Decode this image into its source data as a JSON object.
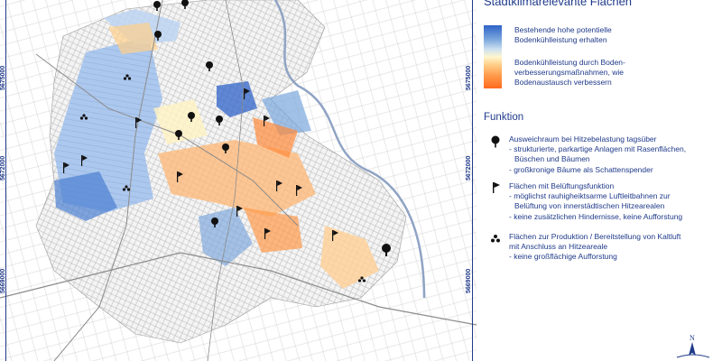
{
  "map": {
    "coordinates": [
      "5675000",
      "5672000",
      "5669000"
    ],
    "colors": {
      "frame": "#1f3a8a",
      "cool": "#2f63c8",
      "cool_light": "#9cc0ea",
      "warm": "#ff9a4a",
      "warm_strong": "#ff6a1f",
      "neutral": "#fff7cf",
      "roads": "#9a9a9a"
    }
  },
  "legend": {
    "title": "Stadtklimarelevante Flächen",
    "gradient_top": [
      "Bestehende hohe potentielle",
      "Bodenkühlleistung erhalten"
    ],
    "gradient_bottom": [
      "Bodenkühlleistung durch Boden-",
      "verbesserungsmaßnahmen, wie",
      "Bodenaustausch verbessern"
    ],
    "section_title": "Funktion",
    "functions": [
      {
        "icon": "tree-icon",
        "lines": [
          "Ausweichraum bei Hitzebelastung tagsüber",
          "- strukturierte, parkartige Anlagen mit Rasenflächen,",
          "  Büschen und Bäumen",
          "- großkronige Bäume als Schattenspender"
        ]
      },
      {
        "icon": "flag-icon",
        "lines": [
          "Flächen mit Belüftungsfunktion",
          "- möglichst rauhigheiktsarme Luftleitbahnen zur",
          "  Belüftung von innerstädtischen Hitzearealen",
          "- keine zusätzlichen Hindernisse, keine Aufforstung"
        ]
      },
      {
        "icon": "cold-air-icon",
        "lines": [
          "Flächen zur Produktion / Bereitstellung von Kaltluft",
          "mit Anschluss an Hitzeareale",
          "- keine großflächige Aufforstung"
        ]
      }
    ],
    "north_label": "N"
  }
}
